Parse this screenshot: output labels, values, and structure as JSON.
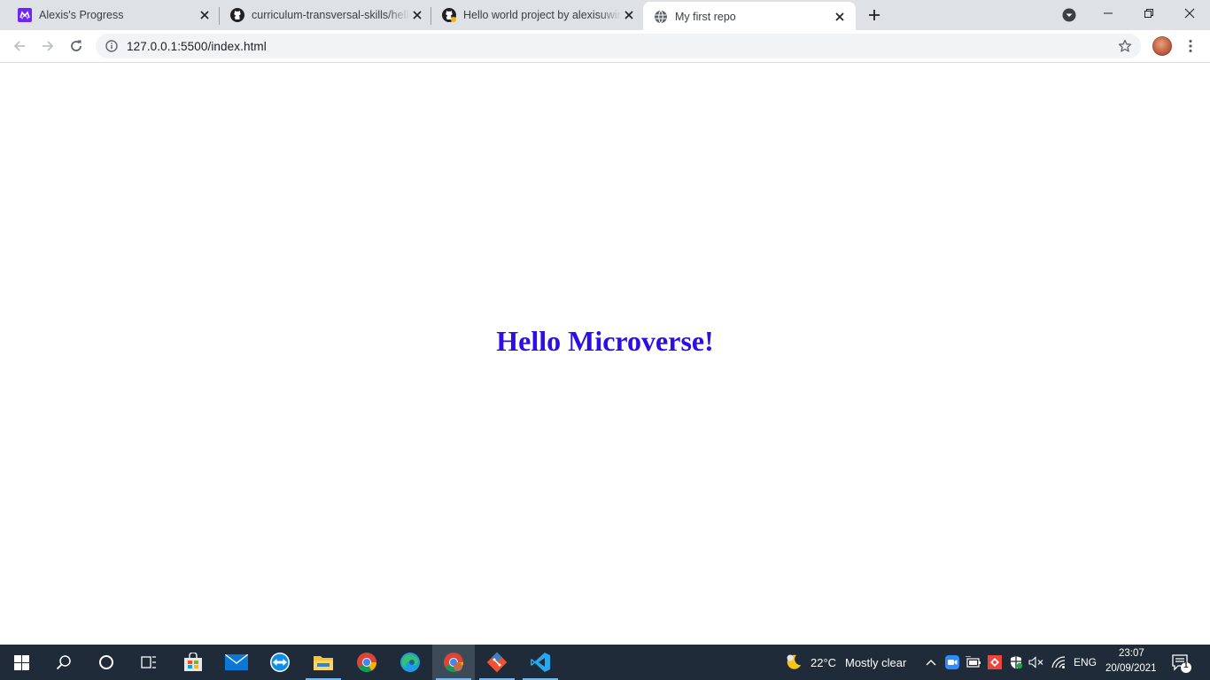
{
  "browser": {
    "tabs": [
      {
        "title": "Alexis's Progress",
        "favicon": "microverse-icon"
      },
      {
        "title": "curriculum-transversal-skills/hello",
        "favicon": "github-icon"
      },
      {
        "title": "Hello world project by alexisuwingimana",
        "favicon": "github-icon"
      },
      {
        "title": "My first repo",
        "favicon": "globe-icon",
        "active": true
      }
    ],
    "url": "127.0.0.1:5500/index.html"
  },
  "page": {
    "heading": "Hello Microverse!",
    "heading_color": "#2b0fe6"
  },
  "taskbar": {
    "apps": [
      "start-icon",
      "search-icon",
      "cortana-icon",
      "task-view-icon",
      "store-icon",
      "mail-icon",
      "teamviewer-icon",
      "file-explorer-icon",
      "chrome-icon",
      "edge-icon",
      "chrome-profile-icon",
      "git-icon",
      "vscode-icon"
    ],
    "weather": {
      "temp": "22°C",
      "condition": "Mostly clear"
    },
    "language": "ENG",
    "time": "23:07",
    "date": "20/09/2021",
    "notification_count": "1"
  }
}
